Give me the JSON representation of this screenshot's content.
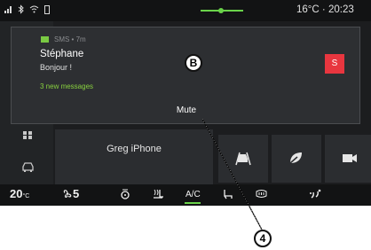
{
  "status_bar": {
    "temperature": "16°C",
    "separator": "·",
    "time": "20:23"
  },
  "notification": {
    "app_meta": "SMS • 7m",
    "sender": "Stéphane",
    "message": "Bonjour !",
    "new_messages": "3 new messages",
    "avatar_letter": "S",
    "mute_label": "Mute"
  },
  "background": {
    "device_label": "Greg iPhone"
  },
  "climate_bar": {
    "temp_left": "20",
    "temp_left_unit": "°C",
    "fan_level": "5",
    "ac_label": "A/C"
  },
  "callouts": {
    "b": "B",
    "four": "4"
  },
  "colors": {
    "accent_green": "#6ad34a",
    "avatar_red": "#e8363f"
  }
}
